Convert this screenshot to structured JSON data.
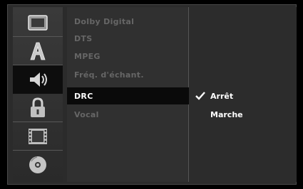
{
  "categories": [
    {
      "icon": "tv-icon",
      "selected": false
    },
    {
      "icon": "language-icon",
      "selected": false
    },
    {
      "icon": "speaker-icon",
      "selected": true
    },
    {
      "icon": "lock-icon",
      "selected": false
    },
    {
      "icon": "film-icon",
      "selected": false
    },
    {
      "icon": "disc-icon",
      "selected": false
    }
  ],
  "menu": [
    {
      "label": "Dolby Digital",
      "active": false
    },
    {
      "label": "DTS",
      "active": false
    },
    {
      "label": "MPEG",
      "active": false
    },
    {
      "label": "Fréq. d'échant.",
      "active": false
    },
    {
      "label": "DRC",
      "active": true
    },
    {
      "label": "Vocal",
      "active": false
    }
  ],
  "options": [
    {
      "label": "Arrêt",
      "checked": true
    },
    {
      "label": "Marche",
      "checked": false
    }
  ]
}
